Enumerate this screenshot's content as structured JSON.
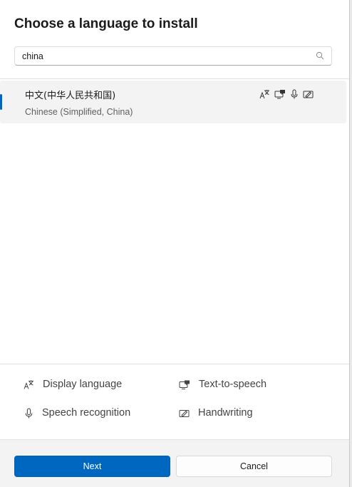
{
  "dialog": {
    "title": "Choose a language to install"
  },
  "search": {
    "value": "china",
    "icon": "search-icon"
  },
  "languages": [
    {
      "native_name": "中文(中华人民共和国)",
      "english_name": "Chinese (Simplified, China)",
      "selected": true,
      "features": [
        "display-language-icon",
        "text-to-speech-icon",
        "speech-recognition-icon",
        "handwriting-icon"
      ]
    }
  ],
  "legend": {
    "display_language": "Display language",
    "text_to_speech": "Text-to-speech",
    "speech_recognition": "Speech recognition",
    "handwriting": "Handwriting"
  },
  "footer": {
    "next_label": "Next",
    "cancel_label": "Cancel"
  },
  "colors": {
    "accent": "#0067c0",
    "selected_row": "#f3f3f3",
    "footer_bg": "#f3f3f3"
  }
}
